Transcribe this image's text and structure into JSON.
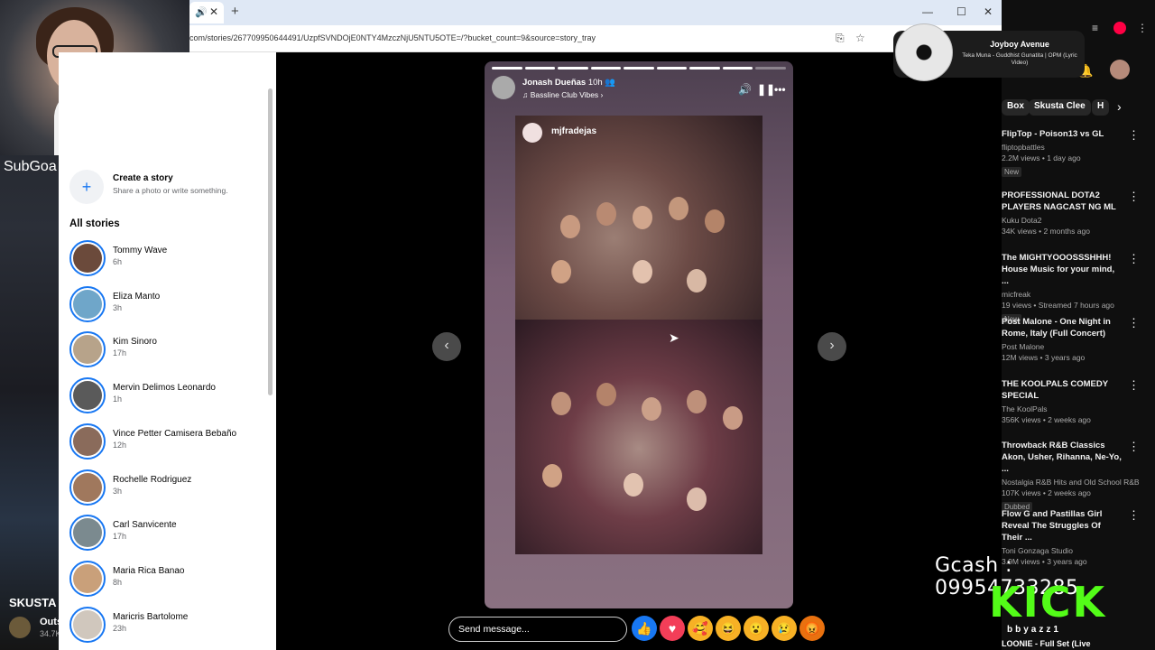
{
  "background": {
    "subgoal_text": "SubGoa",
    "left_title": "SKUSTA",
    "left_channel": "Outs",
    "left_views": "34.7K"
  },
  "browser": {
    "new_tab": "+",
    "url": "com/stories/267709950644491/UzpfSVNDOjE0NTY4MzczNjU5NTU5OTE=/?bucket_count=9&source=story_tray"
  },
  "sidebar": {
    "create_title": "Create a story",
    "create_subtitle": "Share a photo or write something.",
    "all_stories": "All stories",
    "stories": [
      {
        "name": "Tommy Wave",
        "time": "6h",
        "color": "#6b4a3b"
      },
      {
        "name": "Eliza Manto",
        "time": "3h",
        "color": "#6fa6c9"
      },
      {
        "name": "Kim Sinoro",
        "time": "17h",
        "color": "#b7a38a"
      },
      {
        "name": "Mervin Delimos Leonardo",
        "time": "1h",
        "color": "#5a5a5a"
      },
      {
        "name": "Vince Petter Camisera Bebaño",
        "time": "12h",
        "color": "#8a6b5b"
      },
      {
        "name": "Rochelle Rodriguez",
        "time": "3h",
        "color": "#a0785d"
      },
      {
        "name": "Carl Sanvicente",
        "time": "17h",
        "color": "#7b8a8f"
      },
      {
        "name": "Maria Rica Banao",
        "time": "8h",
        "color": "#c9a07a"
      },
      {
        "name": "Maricris Bartolome",
        "time": "23h",
        "color": "#d0c7bd"
      }
    ]
  },
  "story": {
    "author": "Jonash Dueñas",
    "time": "10h",
    "song": "♫ Bassline Club Vibes  ›",
    "photo_user": "mjfradejas",
    "send_placeholder": "Send message...",
    "progress_total": 9,
    "progress_done": 8
  },
  "music": {
    "title": "Joyboy Avenue",
    "subtitle": "Teka Muna - Guddhist Gunatita | OPM (Lyric Video)"
  },
  "youtube": {
    "chips": [
      "Box",
      "Skusta Clee",
      "H"
    ],
    "items": [
      {
        "title": "FlipTop - Poison13 vs GL",
        "channel": "fliptopbattles",
        "meta": "2.2M views • 1 day ago",
        "badge": "New"
      },
      {
        "title": "PROFESSIONAL DOTA2 PLAYERS NAGCAST NG ML",
        "channel": "Kuku Dota2",
        "meta": "34K views • 2 months ago",
        "badge": ""
      },
      {
        "title": "The MIGHTYOOOSSSHHH! House Music for your mind, ...",
        "channel": "micfreak",
        "meta": "19 views • Streamed 7 hours ago",
        "badge": "New"
      },
      {
        "title": "Post Malone - One Night in Rome, Italy (Full Concert)",
        "channel": "Post Malone",
        "meta": "12M views • 3 years ago",
        "badge": ""
      },
      {
        "title": "THE KOOLPALS COMEDY SPECIAL",
        "channel": "The KoolPals",
        "meta": "356K views • 2 weeks ago",
        "badge": ""
      },
      {
        "title": "Throwback R&B Classics Akon, Usher, Rihanna, Ne-Yo, ...",
        "channel": "Nostalgia R&B Hits and Old School R&B",
        "meta": "107K views • 2 weeks ago",
        "badge": "Dubbed"
      },
      {
        "title": "Flow G and Pastillas Girl Reveal The Struggles Of Their ...",
        "channel": "Toni Gonzaga Studio",
        "meta": "3.9M views • 3 years ago",
        "badge": ""
      }
    ],
    "last_item": "LOONIE - Full Set (Live"
  },
  "overlay": {
    "gcash": "Gcash : 09954733285",
    "kick": "KICK",
    "kick_user": "bbyazz1"
  }
}
